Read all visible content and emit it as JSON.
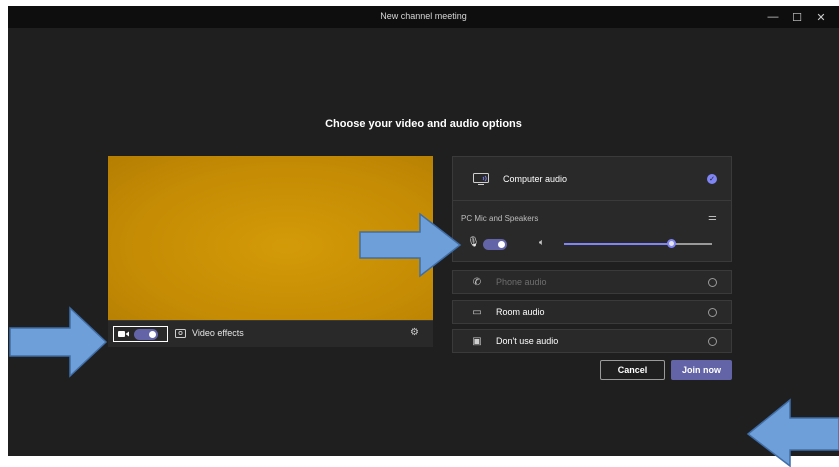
{
  "window": {
    "title": "New channel meeting",
    "controls": {
      "minimize": "—",
      "maximize": "☐",
      "close": "✕"
    }
  },
  "main": {
    "heading": "Choose your video and audio options"
  },
  "video": {
    "effects_label": "Video effects",
    "camera_on": true
  },
  "audio": {
    "computer_audio_label": "Computer audio",
    "device_label": "PC Mic and Speakers",
    "mic_on": true,
    "volume_percent": 72,
    "options": [
      {
        "label": "Phone audio",
        "disabled": true
      },
      {
        "label": "Room audio",
        "disabled": false
      },
      {
        "label": "Don't use audio",
        "disabled": false
      }
    ]
  },
  "actions": {
    "cancel_label": "Cancel",
    "join_label": "Join now"
  },
  "colors": {
    "accent": "#6264a7",
    "accent_light": "#7f85f5",
    "arrow": "#6f9fd8",
    "background": "#1f1f1f"
  },
  "icons": {
    "camera": "camera-icon",
    "effects": "video-effects-icon",
    "settings": "gear-icon",
    "computer": "computer-audio-icon",
    "mic": "microphone-icon",
    "speaker": "speaker-icon",
    "phone": "phone-icon",
    "room": "room-icon",
    "no_audio": "no-audio-icon",
    "equalizer": "equalizer-icon"
  }
}
